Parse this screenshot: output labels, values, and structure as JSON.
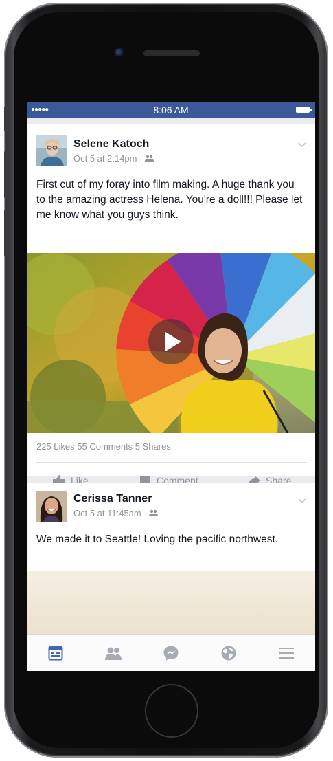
{
  "status_bar": {
    "signal": "●●●●●",
    "time": "8:06 AM"
  },
  "posts": [
    {
      "author": "Selene Katoch",
      "timestamp": "Oct 5 at 2:14pm",
      "audience_icon": "friends-icon",
      "text": "First cut of my foray into film making. A huge thank you to the amazing actress Helena. You're a doll!!! Please let me know what you guys think.",
      "media": "video",
      "stats": "225 Likes  55 Comments  5 Shares",
      "actions": {
        "like": "Like",
        "comment": "Comment",
        "share": "Share"
      }
    },
    {
      "author": "Cerissa Tanner",
      "timestamp": "Oct 5 at 11:45am",
      "audience_icon": "friends-icon",
      "text": "We made it to Seattle! Loving the pacific northwest.",
      "media": "photo"
    }
  ],
  "tabbar": {
    "items": [
      {
        "icon": "news-feed-icon",
        "active": true
      },
      {
        "icon": "friends-icon",
        "active": false
      },
      {
        "icon": "messenger-icon",
        "active": false
      },
      {
        "icon": "globe-icon",
        "active": false
      },
      {
        "icon": "menu-icon",
        "active": false
      }
    ]
  },
  "colors": {
    "brand": "#3b5998",
    "active_tab": "#4267b2",
    "muted": "#90949c",
    "text": "#141823"
  }
}
